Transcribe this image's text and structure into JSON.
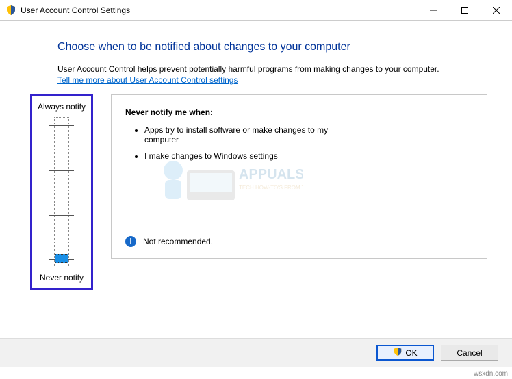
{
  "window": {
    "title": "User Account Control Settings"
  },
  "heading": "Choose when to be notified about changes to your computer",
  "description": "User Account Control helps prevent potentially harmful programs from making changes to your computer.",
  "link_text": "Tell me more about User Account Control settings",
  "slider": {
    "top_label": "Always notify",
    "bottom_label": "Never notify",
    "position_index": 3,
    "levels": 4
  },
  "panel": {
    "title": "Never notify me when:",
    "bullets": [
      "Apps try to install software or make changes to my computer",
      "I make changes to Windows settings"
    ],
    "recommendation": "Not recommended."
  },
  "buttons": {
    "ok": "OK",
    "cancel": "Cancel"
  },
  "watermark": {
    "brand": "APPUALS",
    "tagline": "TECH HOW-TO'S FROM THE EXPERTS!"
  },
  "attribution": "wsxdn.com"
}
